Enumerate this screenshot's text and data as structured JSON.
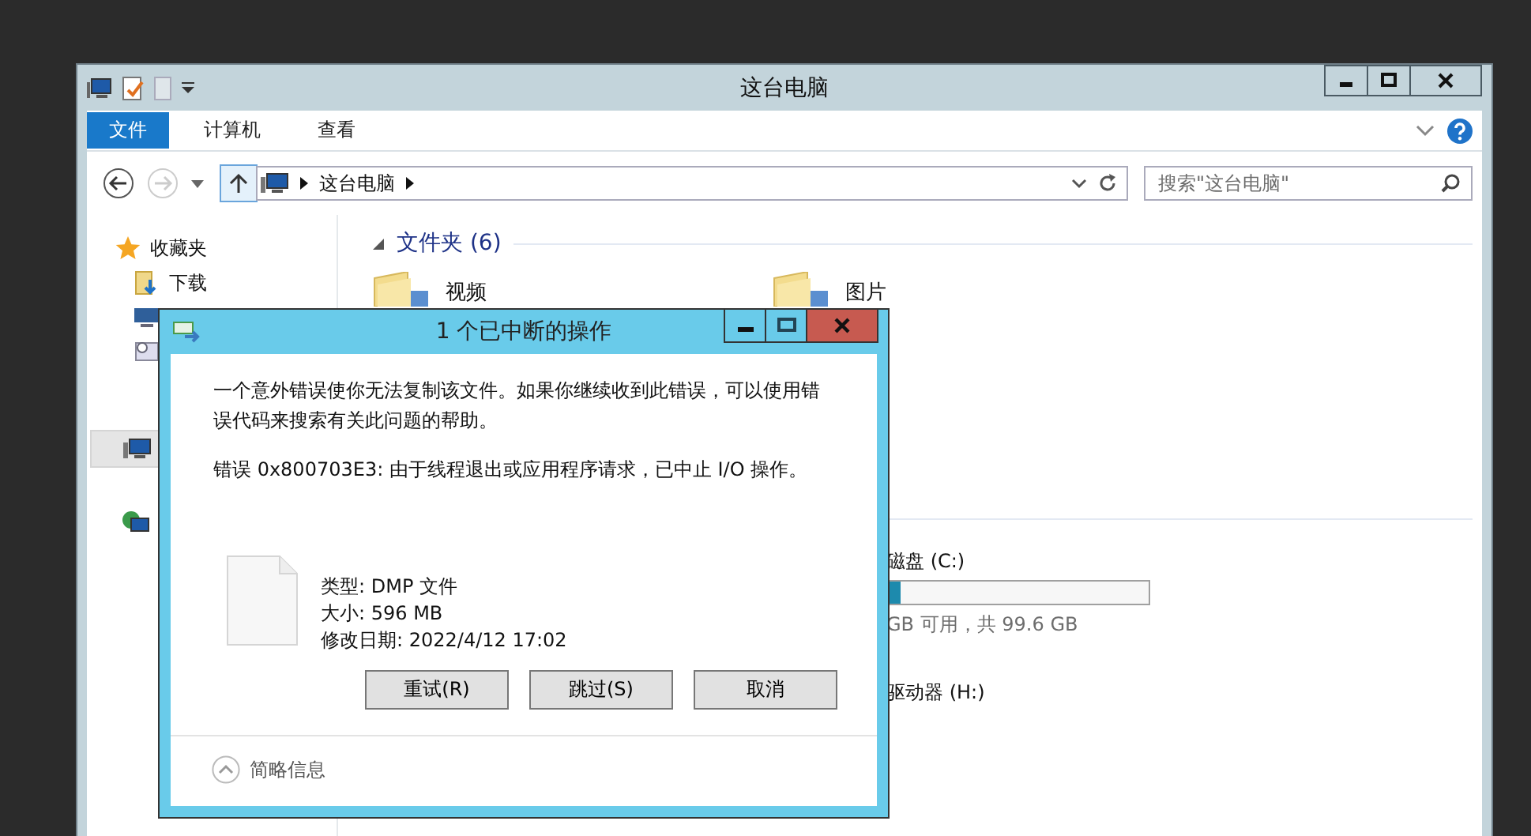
{
  "explorer": {
    "title": "这台电脑",
    "ribbon_tabs": [
      {
        "label": "文件",
        "selected": true
      },
      {
        "label": "计算机",
        "selected": false
      },
      {
        "label": "查看",
        "selected": false
      }
    ],
    "address": {
      "path": [
        "这台电脑"
      ]
    },
    "search": {
      "placeholder": "搜索\"这台电脑\""
    },
    "sidebar": {
      "favorites": "收藏夹",
      "items": [
        {
          "label": "下载"
        }
      ]
    },
    "folders_header": "文件夹 (6)",
    "folders": [
      {
        "name": "视频"
      },
      {
        "name": "图片"
      }
    ],
    "drives": [
      {
        "name": "磁盘 (C:)",
        "level": 0.05,
        "space": "GB 可用，共 99.6 GB"
      },
      {
        "name": "驱动器 (H:)"
      }
    ]
  },
  "dialog": {
    "title": "1 个已中断的操作",
    "message": "一个意外错误使你无法复制该文件。如果你继续收到此错误，可以使用错误代码来搜索有关此问题的帮助。",
    "error": "错误 0x800703E3: 由于线程退出或应用程序请求，已中止 I/O 操作。",
    "file": {
      "type": "类型: DMP 文件",
      "size": "大小: 596 MB",
      "modified": "修改日期: 2022/4/12 17:02"
    },
    "buttons": [
      "重试(R)",
      "跳过(S)",
      "取消"
    ],
    "details_toggle": "简略信息"
  }
}
